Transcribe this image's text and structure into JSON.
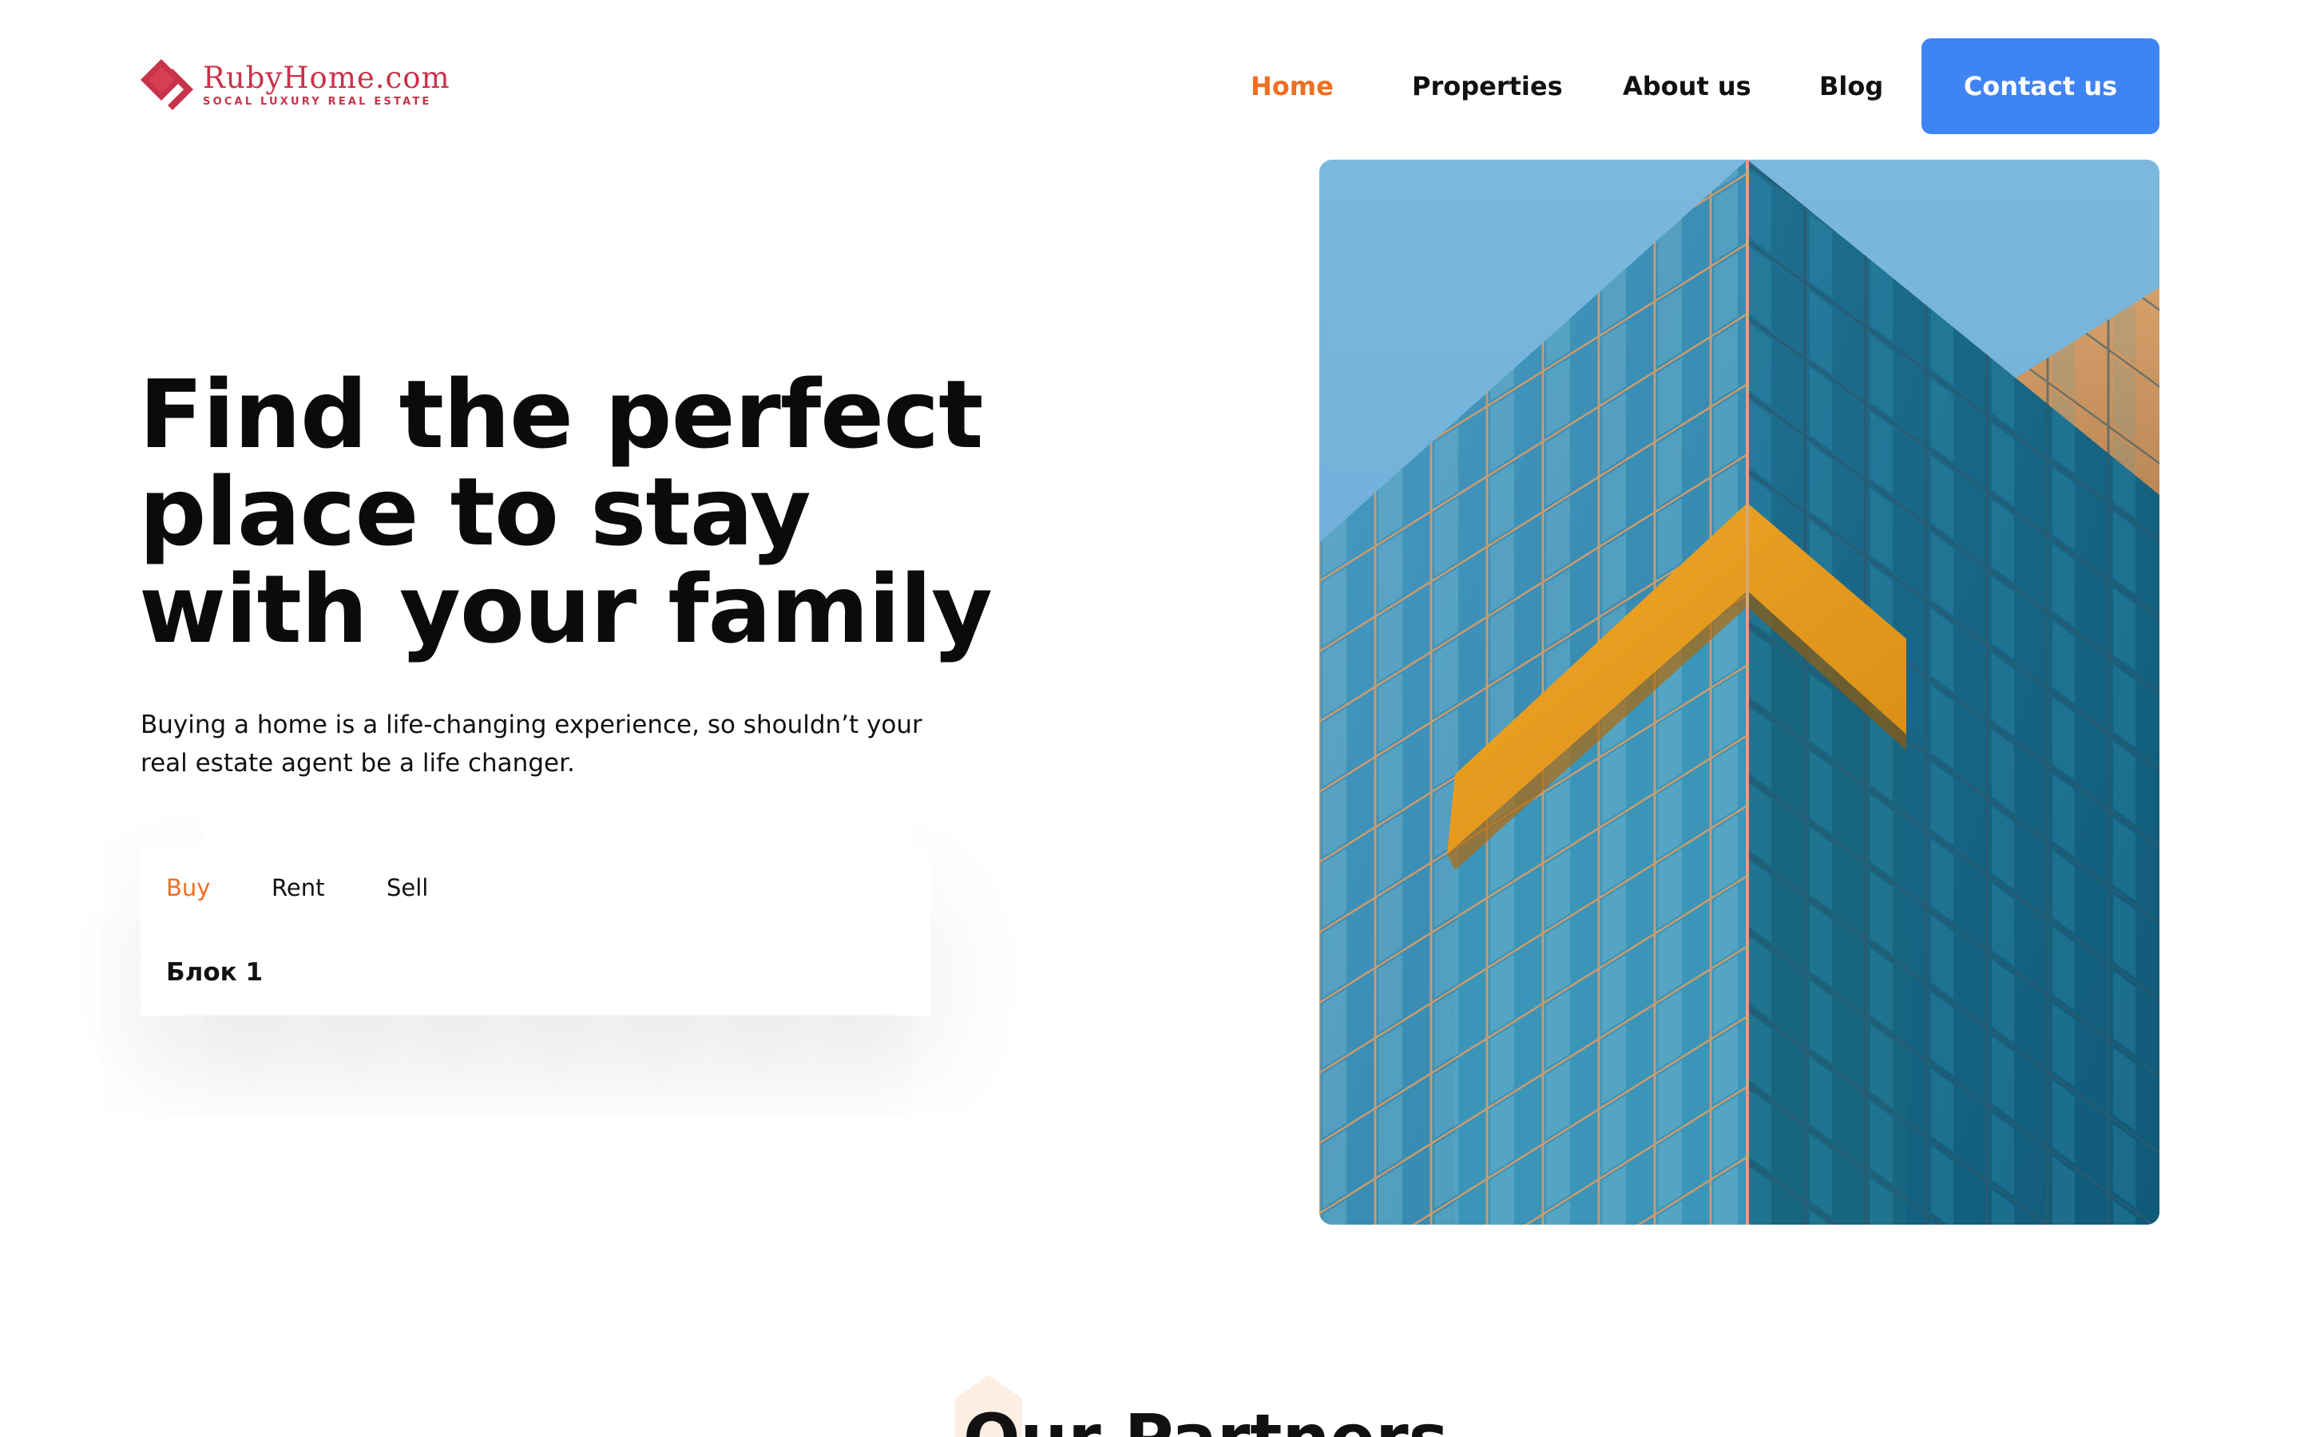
{
  "brand": {
    "name": "RubyHome.com",
    "tagline": "SOCAL LUXURY REAL ESTATE",
    "color": "#c8334a"
  },
  "nav": {
    "items": [
      {
        "label": "Home",
        "active": true
      },
      {
        "label": "Properties",
        "active": false
      },
      {
        "label": "About us",
        "active": false
      },
      {
        "label": "Blog",
        "active": false
      }
    ],
    "contact_label": "Contact us",
    "accent_color": "#ee6f22",
    "button_color": "#3f84f3"
  },
  "hero": {
    "title_lines": [
      "Find the perfect",
      "place to stay",
      "with your family"
    ],
    "subtitle": "Buying a home is a life-changing experience, so shouldn’t your real estate agent be a life changer.",
    "image_icon": "glass-skyscraper-photo"
  },
  "search": {
    "tabs": [
      {
        "label": "Buy",
        "active": true
      },
      {
        "label": "Rent",
        "active": false
      },
      {
        "label": "Sell",
        "active": false
      }
    ],
    "panel_label": "Блок 1"
  },
  "partners": {
    "title": "Our Partners"
  }
}
